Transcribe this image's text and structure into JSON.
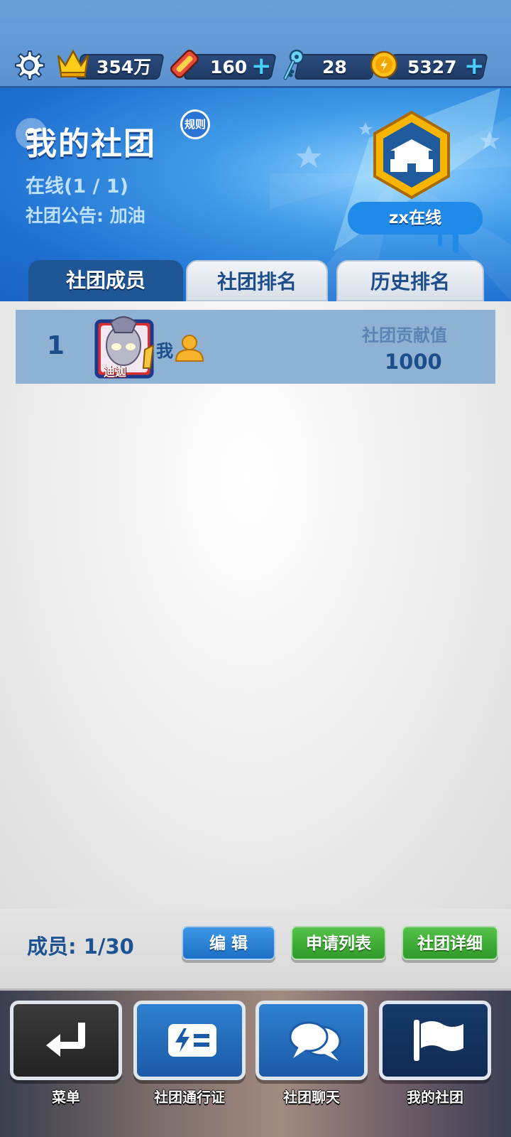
{
  "topbar": {
    "crown_value": "354万",
    "ticket_value": "160",
    "key_value": "28",
    "coin_value": "5327",
    "plus": "+"
  },
  "header": {
    "title": "我的社团",
    "rules": "规则",
    "online": "在线(1 / 1)",
    "notice": "社团公告: 加油",
    "club_name": "zx在线"
  },
  "tabs": [
    "社团成员",
    "社团排名",
    "历史排名"
  ],
  "members": [
    {
      "rank": "1",
      "name": "我",
      "badge_text": "迪迦",
      "contrib_label": "社团贡献值",
      "contrib_value": "1000"
    }
  ],
  "footer": {
    "members_count": "成员: 1/30",
    "edit": "编 辑",
    "apply_list": "申请列表",
    "club_detail": "社团详细"
  },
  "nav": [
    "菜单",
    "社团通行证",
    "社团聊天",
    "我的社团"
  ],
  "colors": {
    "accent_blue": "#1f5796",
    "green_button": "#2f9a2a",
    "plus_cyan": "#4ad0ff"
  },
  "icons": [
    "gear-icon",
    "crown-icon",
    "ticket-icon",
    "key-icon",
    "coin-icon",
    "club-emblem-icon",
    "person-icon",
    "back-icon",
    "pass-icon",
    "chat-icon",
    "flag-icon"
  ]
}
